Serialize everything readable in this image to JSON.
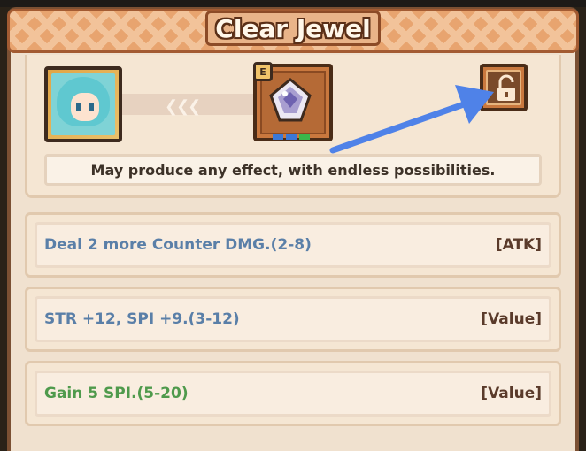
{
  "title": "Clear Jewel",
  "grade_badge": "E",
  "description": "May produce any effect, with endless possibilities.",
  "effects": [
    {
      "text": "Deal 2 more Counter DMG.(2-8)",
      "tag": "[ATK]",
      "color": "#5a7fa8"
    },
    {
      "text": "STR +12, SPI +9.(3-12)",
      "tag": "[Value]",
      "color": "#5a7fa8"
    },
    {
      "text": "Gain 5 SPI.(5-20)",
      "tag": "[Value]",
      "color": "#4f9a4c"
    }
  ],
  "colors": {
    "accent_arrow": "#4f82e8",
    "socket_blue": "#3a78d6",
    "socket_green": "#3ab84a"
  },
  "icons": {
    "hero": "hero-portrait",
    "jewel": "clear-jewel-icon",
    "lock": "unlocked-padlock-icon",
    "chevrons": "left-chevrons-icon"
  }
}
